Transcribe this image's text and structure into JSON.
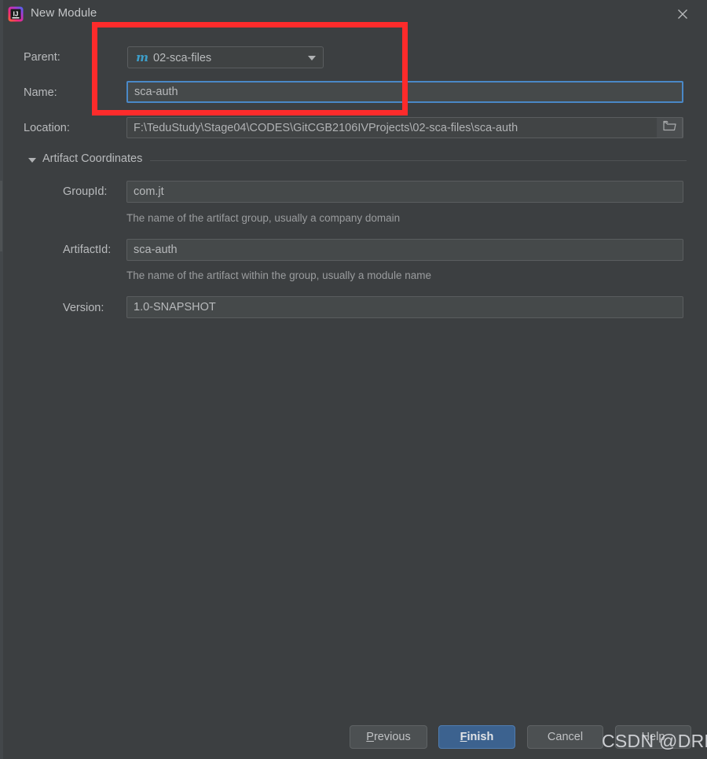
{
  "window": {
    "title": "New Module",
    "logo_icon": "intellij-idea-logo-icon",
    "close_icon": "close-icon"
  },
  "form": {
    "parent": {
      "label": "Parent:",
      "value": "02-sca-files",
      "icon": "maven-module-icon",
      "dropdown_icon": "chevron-down-icon"
    },
    "name": {
      "label": "Name:",
      "value": "sca-auth",
      "focused": true
    },
    "location": {
      "label": "Location:",
      "value": "F:\\TeduStudy\\Stage04\\CODES\\GitCGB2106IVProjects\\02-sca-files\\sca-auth",
      "browse_icon": "folder-icon"
    }
  },
  "artifact_coordinates": {
    "section_title": "Artifact Coordinates",
    "twisty_icon": "triangle-down-icon",
    "group_id": {
      "label": "GroupId:",
      "value": "com.jt",
      "hint": "The name of the artifact group, usually a company domain"
    },
    "artifact_id": {
      "label": "ArtifactId:",
      "value": "sca-auth",
      "hint": "The name of the artifact within the group, usually a module name"
    },
    "version": {
      "label": "Version:",
      "value": "1.0-SNAPSHOT"
    }
  },
  "buttons": {
    "previous": {
      "label": "Previous",
      "mnemonic": "P",
      "rest": "revious"
    },
    "finish": {
      "label": "Finish",
      "mnemonic": "F",
      "rest": "inish",
      "primary": true
    },
    "cancel": {
      "label": "Cancel"
    },
    "help": {
      "label": "Help"
    }
  },
  "annotation": {
    "color": "#fd2b2b",
    "shape": "rectangle-highlight"
  },
  "watermark": {
    "text": "CSDN @DRHJ"
  }
}
